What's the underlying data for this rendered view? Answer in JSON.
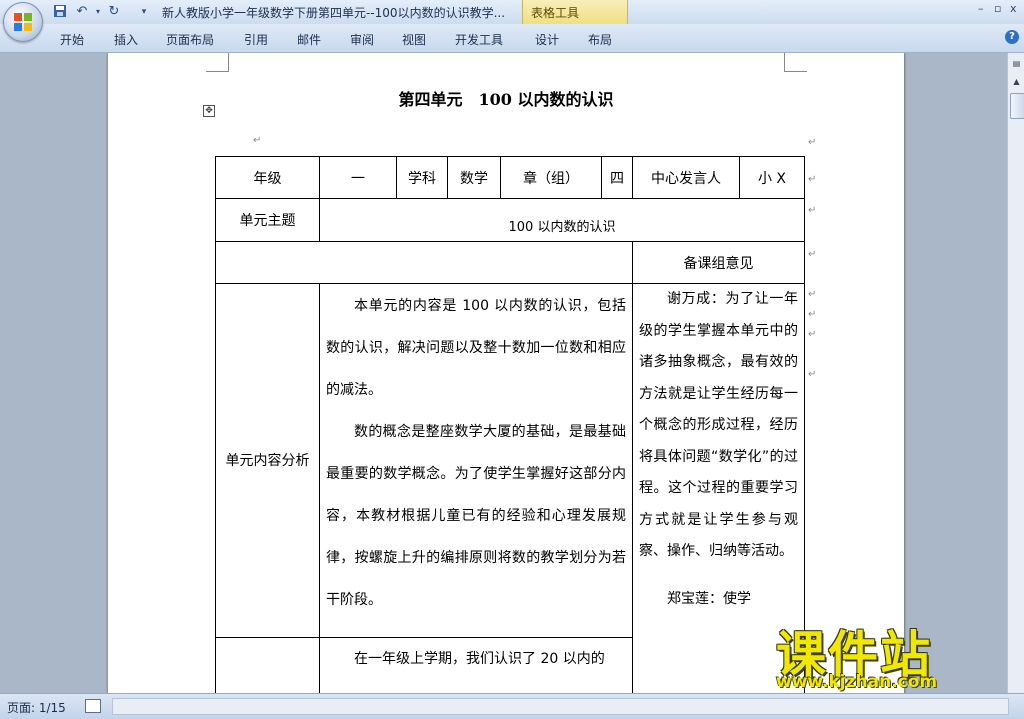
{
  "app": {
    "title": "新人教版小学一年级数学下册第四单元--100以内数的认识教学...",
    "context_tab": "表格工具",
    "window_controls": [
      "–",
      "▫",
      "x"
    ]
  },
  "ribbon": {
    "tabs": [
      "开始",
      "插入",
      "页面布局",
      "引用",
      "邮件",
      "审阅",
      "视图",
      "开发工具",
      "设计",
      "布局"
    ]
  },
  "document": {
    "title": "第四单元　100 以内数的认识",
    "table": {
      "row1": [
        "年级",
        "一",
        "学科",
        "数学",
        "章（组）",
        "四",
        "中心发言人",
        "小 X"
      ],
      "theme_label": "单元主题",
      "theme_value": "100 以内数的认识",
      "opinion_header": "备课组意见",
      "analysis_label": "单元内容分析",
      "analysis_paragraphs": [
        "本单元的内容是 100 以内数的认识，包括数的认识，解决问题以及整十数加一位数和相应的减法。",
        "数的概念是整座数学大厦的基础，是最基础最重要的数学概念。为了使学生掌握好这部分内容，本教材根据儿童已有的经验和心理发展规律，按螺旋上升的编排原则将数的教学划分为若干阶段。"
      ],
      "opinion_1": "谢万成：为了让一年级的学生掌握本单元中的诸多抽象概念，最有效的方法就是让学生经历每一个概念的形成过程，经历将具体问题“数学化”的过程。这个过程的重要学习方式就是让学生参与观察、操作、归纳等活动。",
      "opinion_2": "郑宝莲：使学",
      "next_paragraph": "在一年级上学期，我们认识了 20 以内的"
    }
  },
  "status": {
    "page": "页面: 1/15"
  },
  "watermark": {
    "title": "课件站",
    "url": "www.kjzhan.com"
  },
  "colors": {
    "ribbon_bg": "#c8d8ee",
    "workspace_bg": "#a9b7c9",
    "context_tab": "#f0df83",
    "watermark": "#f0e800"
  }
}
